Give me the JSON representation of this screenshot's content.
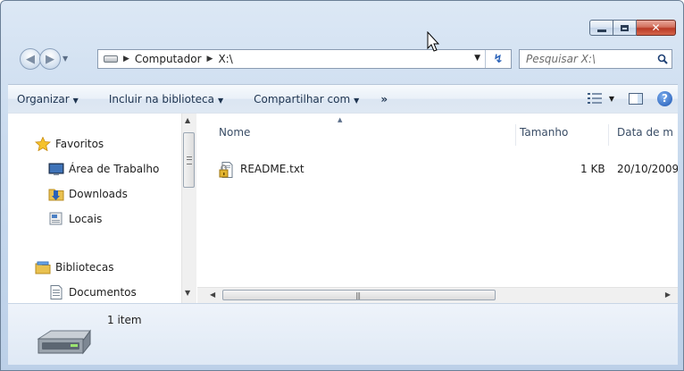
{
  "address": {
    "crumbs": [
      "Computador",
      "X:\\"
    ]
  },
  "search": {
    "placeholder": "Pesquisar X:\\"
  },
  "toolbar": {
    "organize": "Organizar",
    "include_library": "Incluir na biblioteca",
    "share_with": "Compartilhar com",
    "more": "»"
  },
  "nav_pane": {
    "favorites": "Favoritos",
    "items": [
      "Área de Trabalho",
      "Downloads",
      "Locais"
    ],
    "libraries": "Bibliotecas",
    "library_items": [
      "Documentos"
    ]
  },
  "columns": {
    "name": "Nome",
    "size": "Tamanho",
    "date": "Data de m"
  },
  "files": [
    {
      "name": "README.txt",
      "size": "1 KB",
      "date": "20/10/2009"
    }
  ],
  "details": {
    "count": "1 item"
  },
  "icons": {
    "favorites": "star-icon",
    "desktop": "desktop-icon",
    "downloads": "downloads-folder-icon",
    "recent": "recent-places-icon",
    "libraries": "libraries-icon",
    "documents": "documents-icon",
    "file": "locked-text-file-icon",
    "drive": "hard-drive-icon"
  },
  "colors": {
    "accent": "#2a62b8",
    "close_button": "#c4432b"
  }
}
